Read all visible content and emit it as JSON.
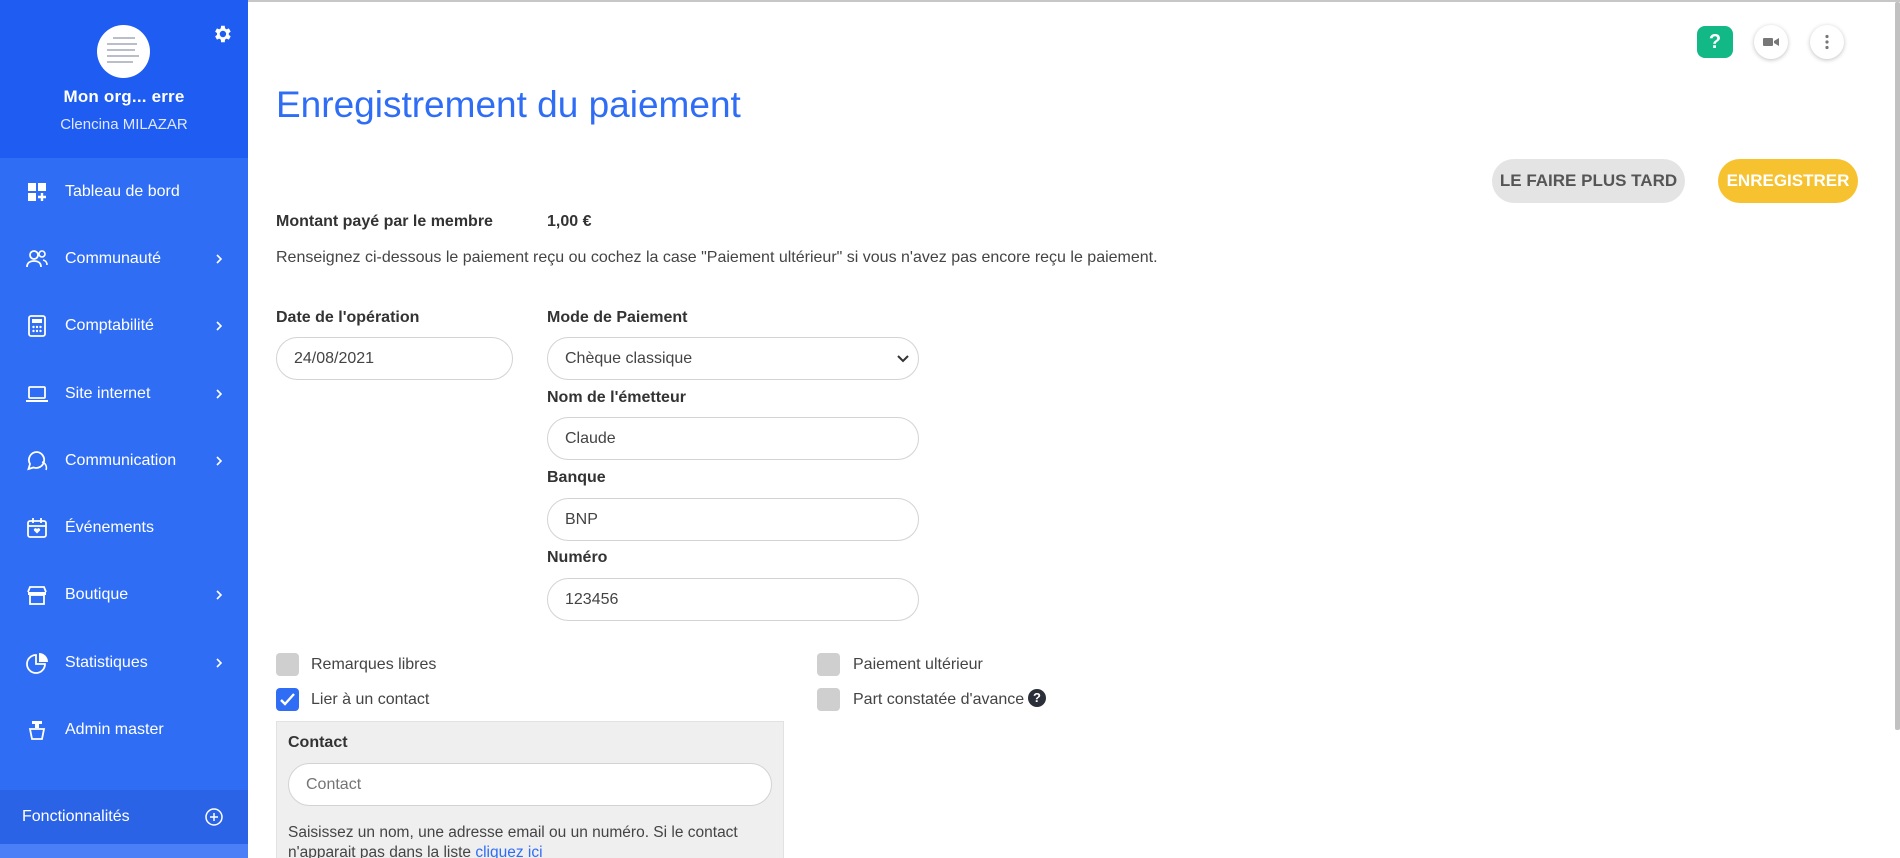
{
  "sidebar": {
    "org_name": "Mon org... erre",
    "user_name": "Clencina MILAZAR",
    "items": [
      {
        "label": "Tableau de bord",
        "icon": "dashboard-icon",
        "has_children": false
      },
      {
        "label": "Communauté",
        "icon": "users-icon",
        "has_children": true
      },
      {
        "label": "Comptabilité",
        "icon": "calculator-icon",
        "has_children": true
      },
      {
        "label": "Site internet",
        "icon": "laptop-icon",
        "has_children": true
      },
      {
        "label": "Communication",
        "icon": "chat-icon",
        "has_children": true
      },
      {
        "label": "Événements",
        "icon": "calendar-icon",
        "has_children": false
      },
      {
        "label": "Boutique",
        "icon": "store-icon",
        "has_children": true
      },
      {
        "label": "Statistiques",
        "icon": "pie-chart-icon",
        "has_children": true
      },
      {
        "label": "Admin master",
        "icon": "admin-icon",
        "has_children": false
      }
    ],
    "features_label": "Fonctionnalités"
  },
  "topbar": {
    "help_label": "?"
  },
  "page": {
    "title": "Enregistrement du paiement",
    "later_button": "LE FAIRE PLUS TARD",
    "save_button": "ENREGISTRER",
    "amount_label": "Montant payé par le membre",
    "amount_value": "1,00 €",
    "intro": "Renseignez ci-dessous le paiement reçu ou cochez la case \"Paiement ultérieur\" si vous n'avez pas encore reçu le paiement."
  },
  "form": {
    "date": {
      "label": "Date de l'opération",
      "value": "24/08/2021"
    },
    "payment_mode": {
      "label": "Mode de Paiement",
      "value": "Chèque classique"
    },
    "issuer": {
      "label": "Nom de l'émetteur",
      "value": "Claude"
    },
    "bank": {
      "label": "Banque",
      "value": "BNP"
    },
    "number": {
      "label": "Numéro",
      "value": "123456"
    }
  },
  "options": {
    "free_remarks": {
      "label": "Remarques libres",
      "checked": false
    },
    "link_contact": {
      "label": "Lier à un contact",
      "checked": true
    },
    "later_payment": {
      "label": "Paiement ultérieur",
      "checked": false
    },
    "advance_share": {
      "label": "Part constatée d'avance",
      "checked": false
    }
  },
  "contact": {
    "label": "Contact",
    "placeholder": "Contact",
    "hint": "Saisissez un nom, une adresse email ou un numéro. Si le contact n'apparait pas dans la liste ",
    "hint_link": "cliquez ici"
  },
  "colors": {
    "accent": "#2f6df5",
    "sidebar_head": "#1f5cf2",
    "save": "#f7c22f",
    "help": "#12b886"
  }
}
